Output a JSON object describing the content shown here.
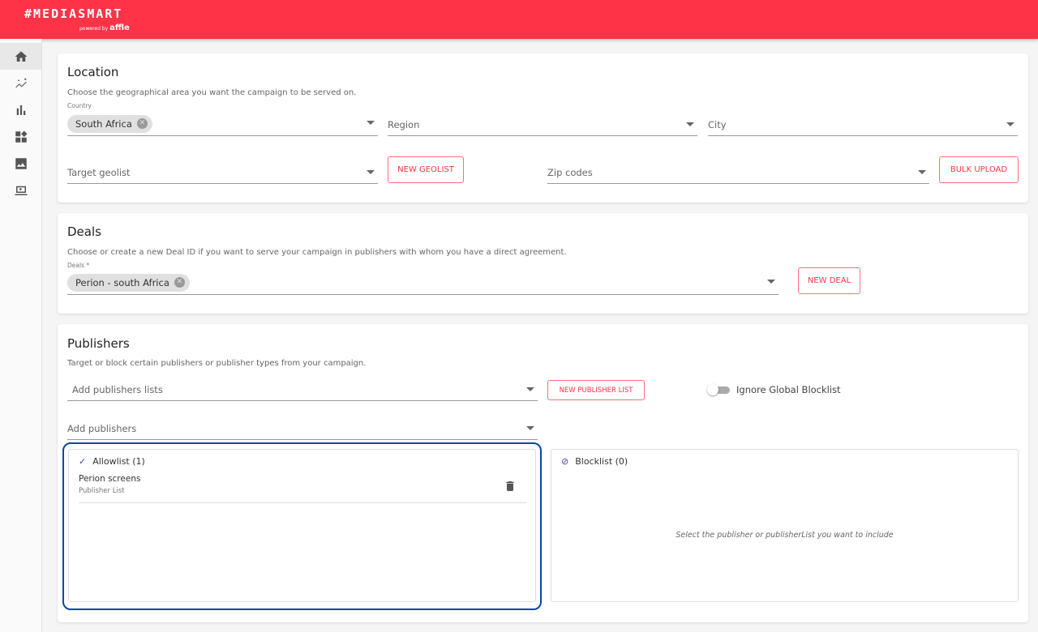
{
  "header": {
    "logo": "#MEDIASMART",
    "powered_by": "powered by",
    "brand": "affle"
  },
  "sidebar": {
    "items": [
      {
        "icon": "home-icon"
      },
      {
        "icon": "insights-icon"
      },
      {
        "icon": "bar-chart-icon"
      },
      {
        "icon": "widgets-icon"
      },
      {
        "icon": "image-icon"
      },
      {
        "icon": "laptop-search-icon"
      }
    ]
  },
  "location": {
    "title": "Location",
    "description": "Choose the geographical area you want the campaign to be served on.",
    "country_label": "Country",
    "country_chip": "South Africa",
    "region_placeholder": "Region",
    "city_placeholder": "City",
    "geolist_placeholder": "Target geolist",
    "new_geolist": "NEW GEOLIST",
    "zip_placeholder": "Zip codes",
    "bulk_upload": "BULK UPLOAD"
  },
  "deals": {
    "title": "Deals",
    "description": "Choose or create a new Deal ID if you want to serve your campaign in publishers with whom you have a direct agreement.",
    "deals_label": "Deals *",
    "deal_chip": "Perion - south Africa",
    "new_deal": "NEW DEAL"
  },
  "publishers": {
    "title": "Publishers",
    "description": "Target or block certain publishers or publisher types from your campaign.",
    "lists_placeholder": "Add publishers lists",
    "new_list": "NEW PUBLISHER LIST",
    "toggle_label": "Ignore Global Blocklist",
    "toggle_on": false,
    "publishers_placeholder": "Add publishers",
    "allowlist": {
      "title": "Allowlist (1)",
      "items": [
        {
          "name": "Perion screens",
          "type": "Publisher List"
        }
      ]
    },
    "blocklist": {
      "title": "Blocklist (0)",
      "empty": "Select the publisher or publisherList you want to include"
    }
  },
  "colors": {
    "brand": "#ff3347",
    "highlight": "#0d47a1"
  }
}
